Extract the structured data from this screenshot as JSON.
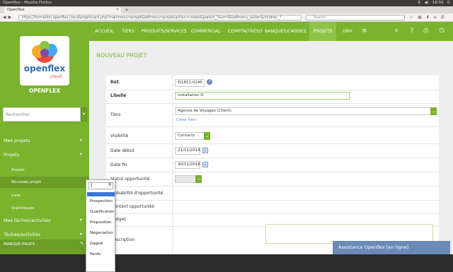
{
  "os": {
    "title": "Openflex - Mozilla Firefox",
    "clock": "16:56"
  },
  "browser": {
    "tab_title": "Openflex",
    "url": "https://formation.openflex.cloud/projet/card.php?mainmenu=projet&leftmenu=projetsaction=create&parent_?&id=0&leftmenu_action&children_?",
    "search_placeholder": "Search"
  },
  "sidebar": {
    "brand": "OPENFLEX",
    "search_placeholder": "Rechercher",
    "items": [
      {
        "label": "Mes projets"
      },
      {
        "label": "Projets"
      },
      {
        "label": "Mes tâches/activités"
      },
      {
        "label": "Tâches/activités"
      },
      {
        "label": "MARQUE-PAGES"
      }
    ],
    "subitems": [
      {
        "label": "Projets"
      },
      {
        "label": "Nouveau projet"
      },
      {
        "label": "Liste"
      },
      {
        "label": "Statistiques"
      }
    ]
  },
  "topnav": {
    "items": [
      "ACCUEIL",
      "TIERS",
      "PRODUITS/SERVICES",
      "COMMERCIAL",
      "COMPTA/TRÉSO",
      "BANQUES/CAISSES",
      "PROJETS",
      "GRH"
    ],
    "active": "PROJETS"
  },
  "page": {
    "title": "NOUVEAU PROJET"
  },
  "form": {
    "ref_label": "Réf.",
    "ref_value": "PJ1811-0246",
    "libelle_label": "Libellé",
    "libelle_value": "Installation D",
    "tiers_label": "Tiers",
    "tiers_value": "Agence de Voyages (Client)",
    "creer_tiers": "Créer tiers",
    "visibilite_label": "Visibilité",
    "visibilite_value": "Contacts ...",
    "date_debut_label": "Date début",
    "date_debut_value": "21/11/2018",
    "date_fin_label": "Date fin",
    "date_fin_value": "30/11/2018",
    "statut_label": "Statut opportunité",
    "proba_label": "Probabilité d'opportunité",
    "montant_label": "Montant opportunité",
    "budget_label": "Budget",
    "description_label": "Description"
  },
  "dropdown": {
    "options": [
      "Prospection",
      "Qualification",
      "Proposition",
      "Négociation",
      "Gagné",
      "Perdu"
    ]
  },
  "chat": {
    "label": "Assistance Openflex [en ligne]"
  },
  "colors": {
    "green": "#7ab32e",
    "blue_link": "#5b8ed2",
    "chat": "#6c8ab6"
  }
}
